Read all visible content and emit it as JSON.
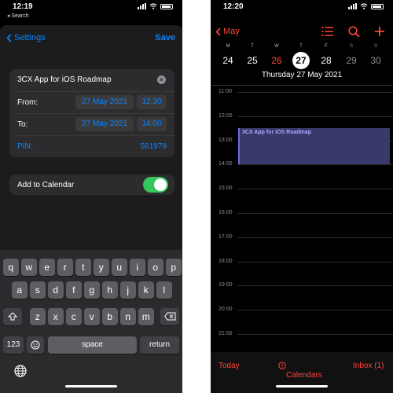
{
  "left": {
    "status": {
      "time": "12:19",
      "back_app": "◂ Search"
    },
    "nav": {
      "back_label": "Settings",
      "save_label": "Save"
    },
    "meeting": {
      "title": "3CX App for iOS Roadmap",
      "from_label": "From:",
      "from_date": "27 May 2021",
      "from_time": "12:30",
      "to_label": "To:",
      "to_date": "27 May 2021",
      "to_time": "14:00",
      "pin_label": "PIN:",
      "pin_value": "561979"
    },
    "calendar_toggle": {
      "label": "Add to Calendar",
      "on": true
    },
    "keyboard": {
      "row1": [
        "q",
        "w",
        "e",
        "r",
        "t",
        "y",
        "u",
        "i",
        "o",
        "p"
      ],
      "row2": [
        "a",
        "s",
        "d",
        "f",
        "g",
        "h",
        "j",
        "k",
        "l"
      ],
      "row3": [
        "z",
        "x",
        "c",
        "v",
        "b",
        "n",
        "m"
      ],
      "numbers": "123",
      "space": "space",
      "return": "return"
    }
  },
  "right": {
    "status": {
      "time": "12:20"
    },
    "nav": {
      "back_label": "May"
    },
    "week_headers": [
      "M",
      "T",
      "W",
      "T",
      "F",
      "S",
      "S"
    ],
    "week_days": [
      "24",
      "25",
      "26",
      "27",
      "28",
      "29",
      "30"
    ],
    "selected_date": "Thursday  27 May 2021",
    "hours": [
      "11:00",
      "12:00",
      "13:00",
      "14:00",
      "15:00",
      "16:00",
      "17:00",
      "18:00",
      "19:00",
      "20:00",
      "21:00"
    ],
    "event": {
      "title": "3CX App for iOS Roadmap",
      "start": "12:30",
      "end": "14:00"
    },
    "tabbar": {
      "today": "Today",
      "calendars": "Calendars",
      "inbox": "Inbox (1)"
    },
    "colors": {
      "accent": "#ff453a",
      "event": "#3a3a6a"
    }
  },
  "colors": {
    "ios_blue": "#0a84ff",
    "switch_green": "#34c759"
  }
}
